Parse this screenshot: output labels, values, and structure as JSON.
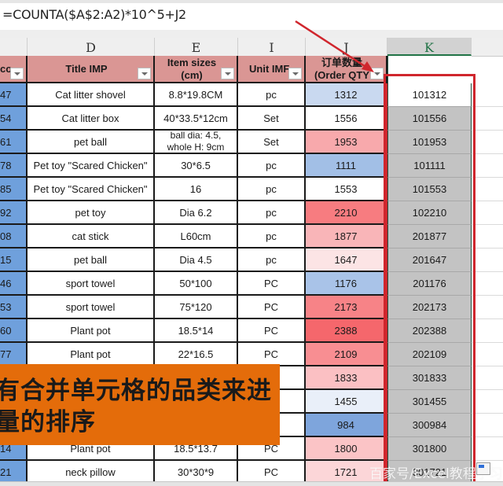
{
  "formula_bar": {
    "formula": "=COUNTA($A$2:A2)*10^5+J2"
  },
  "columns": {
    "letters": [
      "D",
      "E",
      "I",
      "J",
      "K"
    ],
    "selected": "K"
  },
  "table": {
    "headers": {
      "partial": "co",
      "title": "Title IMP",
      "size_line1": "Item sizes",
      "size_line2": "(cm)",
      "unit": "Unit IMF",
      "qty_line1": "订单数量",
      "qty_line2": "(Order QTY"
    },
    "rows": [
      {
        "a": "47",
        "title": "Cat litter shovel",
        "size": "8.8*19.8CM",
        "unit": "pc",
        "qty": "1312",
        "qty_color": "#c9d9f0",
        "k": "101312"
      },
      {
        "a": "54",
        "title": "Cat litter box",
        "size": "40*33.5*12cm",
        "unit": "Set",
        "qty": "1556",
        "qty_color": "#ffffff",
        "k": "101556"
      },
      {
        "a": "61",
        "title": "pet ball",
        "size": "ball dia: 4.5, whole H: 9cm",
        "unit": "Set",
        "qty": "1953",
        "qty_color": "#f8a9ac",
        "k": "101953"
      },
      {
        "a": "78",
        "title": "Pet toy \"Scared Chicken\"",
        "size": "30*6.5",
        "unit": "pc",
        "qty": "1111",
        "qty_color": "#a2bfe6",
        "k": "101111"
      },
      {
        "a": "85",
        "title": "Pet toy \"Scared Chicken\"",
        "size": "16",
        "unit": "pc",
        "qty": "1553",
        "qty_color": "#ffffff",
        "k": "101553"
      },
      {
        "a": "92",
        "title": "pet toy",
        "size": "Dia 6.2",
        "unit": "pc",
        "qty": "2210",
        "qty_color": "#f77c80",
        "k": "102210"
      },
      {
        "a": "08",
        "title": "cat stick",
        "size": "L60cm",
        "unit": "pc",
        "qty": "1877",
        "qty_color": "#f9b5b8",
        "k": "201877"
      },
      {
        "a": "15",
        "title": "pet ball",
        "size": "Dia 4.5",
        "unit": "pc",
        "qty": "1647",
        "qty_color": "#fce4e5",
        "k": "201647"
      },
      {
        "a": "46",
        "title": "sport towel",
        "size": "50*100",
        "unit": "PC",
        "qty": "1176",
        "qty_color": "#a9c3e8",
        "k": "201176"
      },
      {
        "a": "53",
        "title": "sport towel",
        "size": "75*120",
        "unit": "PC",
        "qty": "2173",
        "qty_color": "#f78387",
        "k": "202173"
      },
      {
        "a": "60",
        "title": "Plant pot",
        "size": "18.5*14",
        "unit": "PC",
        "qty": "2388",
        "qty_color": "#f5676c",
        "k": "202388"
      },
      {
        "a": "77",
        "title": "Plant pot",
        "size": "22*16.5",
        "unit": "PC",
        "qty": "2109",
        "qty_color": "#f88e92",
        "k": "202109"
      },
      {
        "a": "",
        "title": "",
        "size": "",
        "unit": "",
        "qty": "1833",
        "qty_color": "#fbc0c3",
        "k": "301833"
      },
      {
        "a": "",
        "title": "",
        "size": "",
        "unit": "",
        "qty": "1455",
        "qty_color": "#e9eff9",
        "k": "301455"
      },
      {
        "a": "",
        "title": "",
        "size": "",
        "unit": "",
        "qty": "984",
        "qty_color": "#7ea5dc",
        "k": "300984"
      },
      {
        "a": "14",
        "title": "Plant pot",
        "size": "18.5*13.7",
        "unit": "PC",
        "qty": "1800",
        "qty_color": "#fbc4c6",
        "k": "301800"
      },
      {
        "a": "21",
        "title": "neck pillow",
        "size": "30*30*9",
        "unit": "PC",
        "qty": "1721",
        "qty_color": "#fcd6d8",
        "k": "301721"
      }
    ]
  },
  "annotation": {
    "banner_line1": "有合并单元格的品类来进",
    "banner_line2": "量的排序",
    "banner_color": "#e46c0a",
    "highlight_color": "#d0262d"
  },
  "watermark": "百家号/Excel教程学习"
}
